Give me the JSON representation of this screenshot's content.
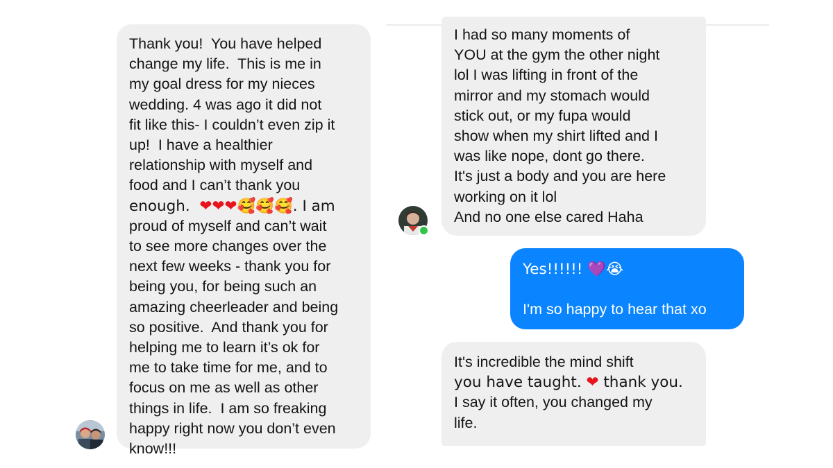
{
  "left_thread": {
    "message": {
      "lines": [
        "Thank you!  You have helped",
        "change my life.  This is me in",
        "my goal dress for my nieces",
        "wedding. 4 was ago it did not",
        "fit like this- I couldn’t even zip it",
        "up!  I have a healthier",
        "relationship with myself and",
        "food and I can’t thank you",
        "enough.  ❤❤❤🥰🥰🥰. I am",
        "proud of myself and can’t wait",
        "to see more changes over the",
        "next few weeks - thank you for",
        "being you, for being such an",
        "amazing cheerleader and being",
        "so positive.  And thank you for",
        "helping me to learn it’s ok for",
        "me to take time for me, and to",
        "focus on me as well as other",
        "things in life.  I am so freaking",
        "happy right now you don’t even",
        "know!!!"
      ]
    },
    "avatar_icon": "user-avatar-photo"
  },
  "right_thread": {
    "message_1": {
      "lines": [
        "I had so many moments of",
        "YOU at the gym the other night",
        "lol I was lifting in front of the",
        "mirror and my stomach would",
        "stick out, or my fupa would",
        "show when my shirt lifted and I",
        "was like nope, dont go there.",
        "It's just a body and you are here",
        "working on it lol",
        "And no one else cared Haha"
      ]
    },
    "reply": {
      "lines": [
        "Yes!!!!!! 💜😭",
        "",
        "I'm so happy to hear that xo"
      ]
    },
    "message_2": {
      "lines": [
        "It's incredible the mind shift",
        "you have taught. ❤ thank you.",
        "I say it often, you changed my",
        "life."
      ]
    },
    "avatar_icon": "user-avatar-photo",
    "online_status": "active-now-dot"
  },
  "colors": {
    "received_bubble": "#efefef",
    "sent_bubble": "#0a84ff",
    "online": "#31c44a",
    "heart": "#e8141c",
    "purple_heart": "#8b3fd8"
  }
}
